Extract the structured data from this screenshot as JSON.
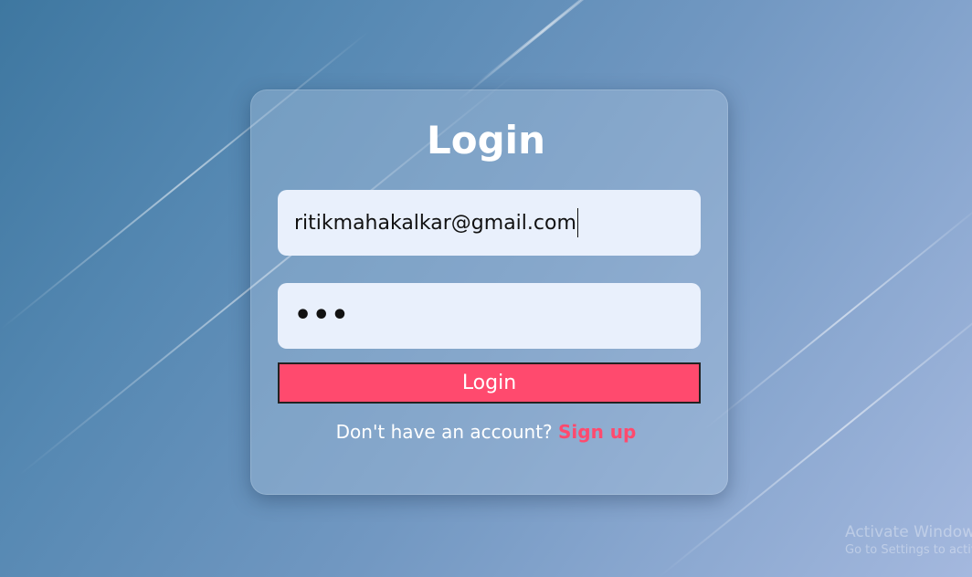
{
  "login_form": {
    "title": "Login",
    "email_value": "ritikmahakalkar@gmail.com",
    "password_masked": "•••",
    "login_button_label": "Login",
    "signup_prompt": "Don't have an account?",
    "signup_link_label": "Sign up"
  },
  "watermark": {
    "line1": "Activate Windows",
    "line2": "Go to Settings to activate Windows."
  },
  "colors": {
    "accent": "#ff4a6e",
    "input_bg": "#e9f0fc"
  }
}
